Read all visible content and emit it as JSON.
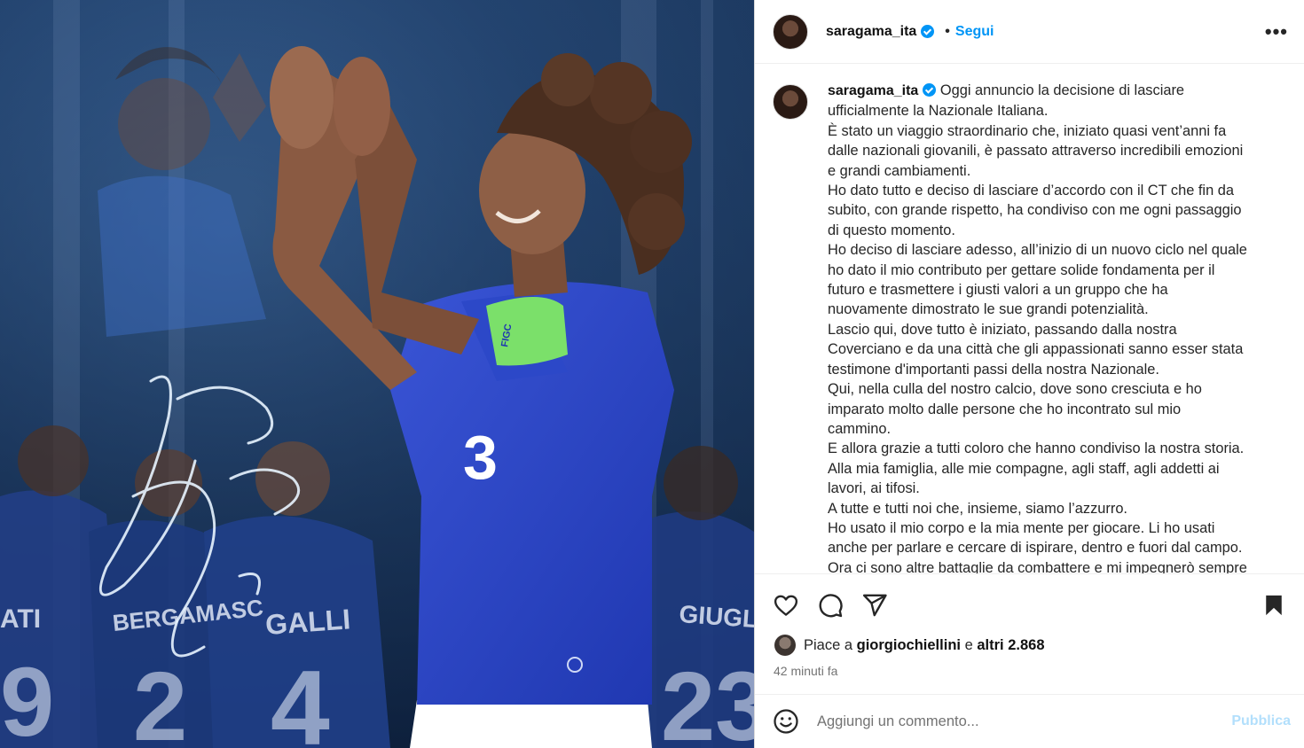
{
  "post": {
    "username": "saragama_ita",
    "follow_label": "Segui",
    "dot": "•",
    "more_label": "•••",
    "caption_lines": [
      "Oggi annuncio la decisione di lasciare",
      "ufficialmente la Nazionale Italiana.",
      "È stato un viaggio straordinario che, iniziato quasi vent’anni fa",
      "dalle nazionali giovanili, è passato attraverso incredibili emozioni",
      "e grandi cambiamenti.",
      "Ho dato tutto e deciso di lasciare d’accordo con il CT che fin da",
      "subito, con grande rispetto, ha condiviso con me ogni passaggio",
      "di questo momento.",
      "Ho deciso di lasciare adesso, all’inizio di un nuovo ciclo nel quale",
      "ho dato il mio contributo per gettare solide fondamenta per il",
      "futuro e trasmettere i giusti valori a un gruppo che ha",
      "nuovamente dimostrato le sue grandi potenzialità.",
      "Lascio qui, dove tutto è iniziato, passando dalla nostra",
      "Coverciano e da una città che gli appassionati sanno esser stata",
      "testimone d'importanti passi della nostra Nazionale.",
      "Qui, nella culla del nostro calcio, dove sono cresciuta e ho",
      "imparato molto dalle persone che ho incontrato sul mio",
      "cammino.",
      "E allora grazie a tutti coloro che hanno condiviso la nostra storia.",
      "Alla mia famiglia, alle mie compagne, agli staff, agli addetti ai",
      "lavori, ai tifosi.",
      "A tutte e tutti noi che, insieme, siamo l’azzurro.",
      "Ho usato il mio corpo e la mia mente per giocare. Li ho usati",
      "anche per parlare e cercare di ispirare, dentro e fuori dal campo.",
      "Ora ci sono altre battaglie da combattere e mi impegnerò sempre"
    ],
    "likes_prefix": "Piace a",
    "likes_user": "giorgiochiellini",
    "likes_and": "e",
    "likes_others": "altri 2.868",
    "time_ago": "42 minuti fa",
    "comment_placeholder": "Aggiungi un commento...",
    "publish_label": "Pubblica"
  },
  "image": {
    "jersey_number": "3",
    "back_names": [
      "ATI",
      "BERGAMASC",
      "GALLI",
      "GIUGLIANO"
    ],
    "back_numbers": [
      "9",
      "2",
      "4",
      "23"
    ],
    "armband_text": "FIGC"
  },
  "icons": [
    "verified-icon",
    "heart-icon",
    "comment-icon",
    "share-icon",
    "bookmark-icon",
    "emoji-icon"
  ],
  "colors": {
    "accent": "#0095f6",
    "publish_disabled": "#b2dffc",
    "muted": "#737373"
  }
}
